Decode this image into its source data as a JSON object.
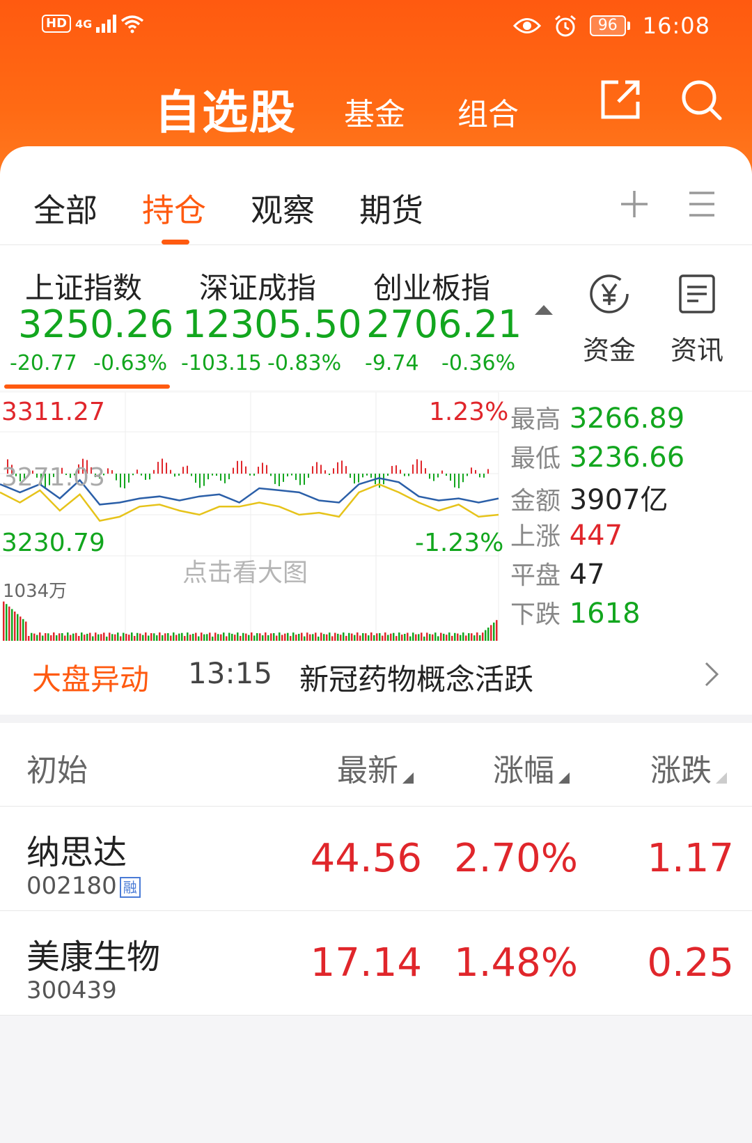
{
  "status_bar": {
    "hd": "HD",
    "network": "4G",
    "battery": "96",
    "time": "16:08"
  },
  "nav": {
    "title": "自选股",
    "tabs": [
      "基金",
      "组合"
    ]
  },
  "subtabs": [
    {
      "label": "全部",
      "active": false
    },
    {
      "label": "持仓",
      "active": true
    },
    {
      "label": "观察",
      "active": false
    },
    {
      "label": "期货",
      "active": false
    }
  ],
  "indexes": [
    {
      "name": "上证指数",
      "value": "3250.26",
      "change": "-20.77",
      "pct": "-0.63%"
    },
    {
      "name": "深证成指",
      "value": "12305.50",
      "change": "-103.15",
      "pct": "-0.83%"
    },
    {
      "name": "创业板指",
      "value": "2706.21",
      "change": "-9.74",
      "pct": "-0.36%"
    }
  ],
  "side_buttons": {
    "funds": "资金",
    "news": "资讯"
  },
  "chart": {
    "high_label": "3311.27",
    "mid_label": "3271.03",
    "low_label": "3230.79",
    "high_pct": "1.23%",
    "low_pct": "-1.23%",
    "volume_label": "1034万",
    "hint": "点击看大图"
  },
  "chart_data": {
    "type": "line",
    "ylim": [
      3230.79,
      3311.27
    ],
    "series": [
      {
        "values": [
          3266,
          3262,
          3266,
          3259,
          3268,
          3256,
          3257,
          3259,
          3260,
          3258,
          3260,
          3261,
          3257,
          3264,
          3263,
          3262,
          3258,
          3257,
          3266,
          3269,
          3267,
          3260,
          3258,
          3259,
          3257,
          3259
        ]
      },
      {
        "values": [
          3262,
          3257,
          3263,
          3253,
          3261,
          3248,
          3250,
          3255,
          3256,
          3253,
          3251,
          3255,
          3255,
          3257,
          3255,
          3251,
          3252,
          3250,
          3262,
          3266,
          3262,
          3257,
          3253,
          3256,
          3250,
          3251
        ]
      }
    ]
  },
  "stats": [
    {
      "key": "最高",
      "value": "3266.89",
      "color": "#12a61e"
    },
    {
      "key": "最低",
      "value": "3236.66",
      "color": "#12a61e"
    },
    {
      "key": "金额",
      "value": "3907亿",
      "color": "#222222"
    },
    {
      "key": "上涨",
      "value": "447",
      "color": "#e0262b"
    },
    {
      "key": "平盘",
      "value": "47",
      "color": "#222222"
    },
    {
      "key": "下跌",
      "value": "1618",
      "color": "#12a61e"
    }
  ],
  "alert": {
    "tag": "大盘异动",
    "time": "13:15",
    "message": "新冠药物概念活跃"
  },
  "table": {
    "headers": {
      "name": "初始",
      "latest": "最新",
      "change_pct": "涨幅",
      "change": "涨跌"
    },
    "rows": [
      {
        "name": "纳思达",
        "code": "002180",
        "badge": "融",
        "latest": "44.56",
        "change_pct": "2.70%",
        "change": "1.17"
      },
      {
        "name": "美康生物",
        "code": "300439",
        "latest": "17.14",
        "change_pct": "1.48%",
        "change": "0.25"
      }
    ]
  },
  "colors": {
    "brand": "#ff5a10",
    "up": "#e0262b",
    "down": "#12a61e",
    "index_line": "#2b5fa8",
    "avg_line": "#e6c31a"
  }
}
